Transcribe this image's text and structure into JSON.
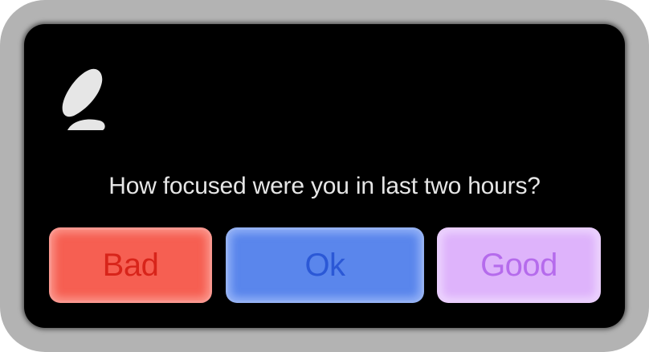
{
  "dialog": {
    "logo_icon": "leaf-logo-icon",
    "question": "How focused were you in last two hours?",
    "buttons": {
      "bad": {
        "label": "Bad",
        "color": "#f65f52",
        "text_color": "#d8241a"
      },
      "ok": {
        "label": "Ok",
        "color": "#5a86ec",
        "text_color": "#2b58d6"
      },
      "good": {
        "label": "Good",
        "color": "#deb3fb",
        "text_color": "#b56bec"
      }
    }
  },
  "colors": {
    "frame": "#b3b3b3",
    "card": "#000000",
    "text": "#e6e6e6"
  }
}
